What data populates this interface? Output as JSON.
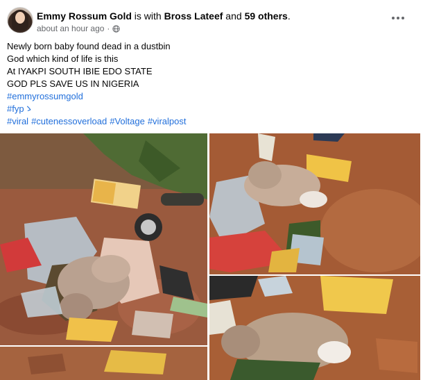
{
  "post": {
    "author": {
      "name": "Emmy Rossum Gold",
      "with_text": " is with ",
      "tagged_name": "Bross Lateef",
      "and_text": " and ",
      "others": "59 others",
      "period": "."
    },
    "timestamp": "about an hour ago",
    "separator": "·",
    "privacy_icon": "globe-icon",
    "more_icon": "more-options-icon",
    "lines": [
      "Newly born baby found dead in a dustbin",
      "God which kind of life is this",
      "At IYAKPI SOUTH IBIE EDO STATE",
      "GOD PLS SAVE US IN NIGERIA"
    ],
    "hashtags": {
      "line1": "#emmyrossumgold",
      "line2": "#fypゝ",
      "line3": [
        "#viral",
        "#cutenessoverload",
        "#Voltage",
        "#viralpost"
      ]
    },
    "colors": {
      "link": "#216fdb",
      "meta": "#65676b",
      "text": "#050505"
    }
  }
}
